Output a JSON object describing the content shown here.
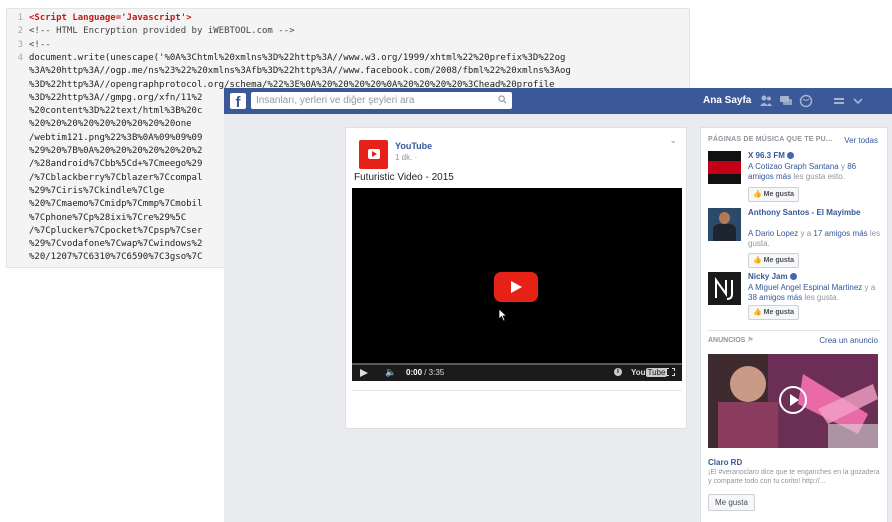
{
  "code": {
    "lines": [
      {
        "n": "1",
        "text": "<Script Language='Javascript'>",
        "kind": "tag"
      },
      {
        "n": "2",
        "text": "<!-- HTML Encryption provided by iWEBTOOL.com -->",
        "kind": "comment"
      },
      {
        "n": "3",
        "text": "<!--",
        "kind": "comment"
      },
      {
        "n": "4",
        "text": "document.write(unescape('%0A%3Chtml%20xmlns%3D%22http%3A//www.w3.org/1999/xhtml%22%20prefix%3D%22og",
        "kind": "code"
      },
      {
        "n": "",
        "text": "%3A%20http%3A//ogp.me/ns%23%22%20xmlns%3Afb%3D%22http%3A//www.facebook.com/2008/fbml%22%20xmlns%3Aog",
        "kind": "code"
      },
      {
        "n": "",
        "text": "%3D%22http%3A//opengraphprotocol.org/schema/%22%3E%0A%20%20%20%20%0A%20%20%20%20%3Chead%20profile",
        "kind": "code"
      },
      {
        "n": "",
        "text": "%3D%22http%3A//gmpg.org/xfn/11%2",
        "kind": "code"
      },
      {
        "n": "",
        "text": "%20content%3D%22text/html%3B%20c",
        "kind": "code"
      },
      {
        "n": "",
        "text": "%20%20%20%20%20%20%20%20%20one",
        "kind": "code"
      },
      {
        "n": "",
        "text": "/webtim121.png%22%3B%0A%09%09%09",
        "kind": "code"
      },
      {
        "n": "",
        "text": "%29%20%7B%0A%20%20%20%20%20%20%2",
        "kind": "code"
      },
      {
        "n": "",
        "text": "/%28android%7Cbb%5Cd+%7Cmeego%29",
        "kind": "code"
      },
      {
        "n": "",
        "text": "/%7Cblackberry%7Cblazer%7Ccompal",
        "kind": "code"
      },
      {
        "n": "",
        "text": "%29%7Ciris%7Ckindle%7Clge",
        "kind": "code"
      },
      {
        "n": "",
        "text": "%20%7Cmaemo%7Cmidp%7Cmmp%7Cmobil",
        "kind": "code"
      },
      {
        "n": "",
        "text": "%7Cphone%7Cp%28ixi%7Cre%29%5C",
        "kind": "code"
      },
      {
        "n": "",
        "text": "/%7Cplucker%7Cpocket%7Cpsp%7Cser",
        "kind": "code"
      },
      {
        "n": "",
        "text": "%29%7Cvodafone%7Cwap%7Cwindows%2",
        "kind": "code"
      },
      {
        "n": "",
        "text": "%20/1207%7C6310%7C6590%7C3gso%7C",
        "kind": "code"
      }
    ]
  },
  "facebook": {
    "logo": "f",
    "search": {
      "placeholder": "İnsanları, yerleri ve diğer şeyleri ara"
    },
    "nav": {
      "home": "Ana Sayfa"
    },
    "post": {
      "page_name": "YouTube",
      "time": "1 dk. ·",
      "title": "Futuristic Video - 2015",
      "video_current": "0:00",
      "video_total": " / 3:35",
      "video_brand": "Tube",
      "video_brand_prefix": "You"
    },
    "sidebar": {
      "heading": "PÁGINAS DE MÚSICA QUE TE PU...",
      "see_all": "Ver todas",
      "suggestions": [
        {
          "name": "X 96.3 FM",
          "desc_link": "A Cotizao Graph Santana",
          "desc_mid": " y ",
          "desc_link2": "86 amigos más",
          "desc_end": " les gusta esto.",
          "like": "Me gusta",
          "color": "#111111"
        },
        {
          "name": "Anthony Santos - El Mayimbe",
          "desc_link": "A Dario Lopez",
          "desc_mid": " y a ",
          "desc_link2": "17 amigos más",
          "desc_end": " les gusta.",
          "like": "Me gusta",
          "color": "#2b4a6b"
        },
        {
          "name": "Nicky Jam",
          "desc_link": "A Miguel Angel Espinal Martinez",
          "desc_mid": " y a ",
          "desc_link2": "38 amigos más",
          "desc_end": " les gusta.",
          "like": "Me gusta",
          "color": "#1a1a1a"
        }
      ],
      "ads_heading": "ANUNCIOS",
      "ads_create": "Crea un anuncio",
      "ad_title": "Claro RD",
      "ad_desc": "¡El #veranoclaro dice que te enganches en la gozadera y comparte todo con tu corito! http://...",
      "ad_like": "Me gusta"
    }
  }
}
